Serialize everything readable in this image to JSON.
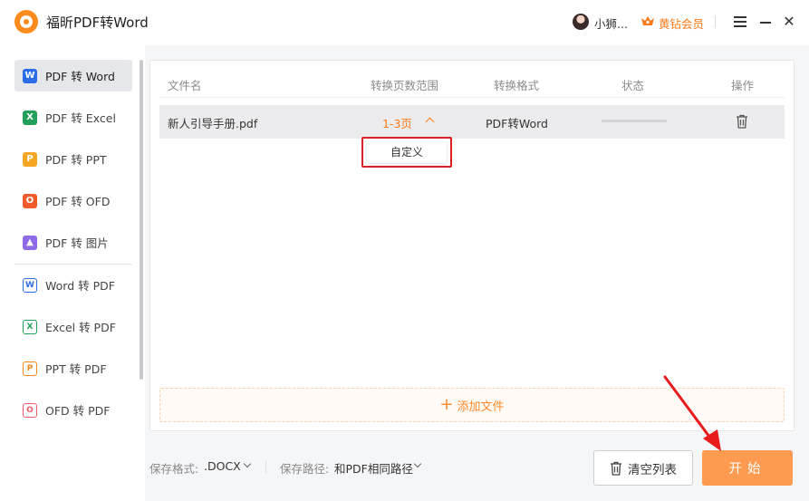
{
  "app": {
    "title": "福昕PDF转Word"
  },
  "user": {
    "name": "小狮...",
    "vip_label": "黄钻会员"
  },
  "colors": {
    "accent": "#ff7a1a",
    "start_button": "#ff9b50",
    "highlight_box": "#e02020"
  },
  "sidebar": {
    "items": [
      {
        "label": "PDF 转 Word",
        "icon": "word-icon",
        "glyph": "W",
        "color": "#2b6de8",
        "active": true
      },
      {
        "label": "PDF 转 Excel",
        "icon": "excel-icon",
        "glyph": "X",
        "color": "#21a05a"
      },
      {
        "label": "PDF 转 PPT",
        "icon": "ppt-icon",
        "glyph": "P",
        "color": "#f6a623"
      },
      {
        "label": "PDF 转 OFD",
        "icon": "ofd-icon",
        "glyph": "O",
        "color": "#f25c2a"
      },
      {
        "label": "PDF 转 图片",
        "icon": "image-icon",
        "glyph": "▲",
        "color": "#8e6ae8"
      },
      {
        "label": "Word 转 PDF",
        "icon": "word-outline-icon",
        "glyph": "W",
        "color": "#2b6de8"
      },
      {
        "label": "Excel 转 PDF",
        "icon": "excel-outline-icon",
        "glyph": "X",
        "color": "#21a05a"
      },
      {
        "label": "PPT 转 PDF",
        "icon": "ppt-outline-icon",
        "glyph": "P",
        "color": "#f28a1e"
      },
      {
        "label": "OFD 转 PDF",
        "icon": "ofd-outline-icon",
        "glyph": "O",
        "color": "#f25c6a"
      }
    ]
  },
  "table": {
    "headers": {
      "name": "文件名",
      "range": "转换页数范围",
      "format": "转换格式",
      "status": "状态",
      "action": "操作"
    },
    "rows": [
      {
        "name": "新人引导手册.pdf",
        "range": "1-3页",
        "format": "PDF转Word"
      }
    ]
  },
  "dropdown": {
    "option": "自定义"
  },
  "add_file": {
    "label": "添加文件"
  },
  "bottom": {
    "format_label": "保存格式:",
    "format_value": ".DOCX",
    "path_label": "保存路径:",
    "path_value": "和PDF相同路径",
    "clear_label": "清空列表",
    "start_label": "开始"
  }
}
